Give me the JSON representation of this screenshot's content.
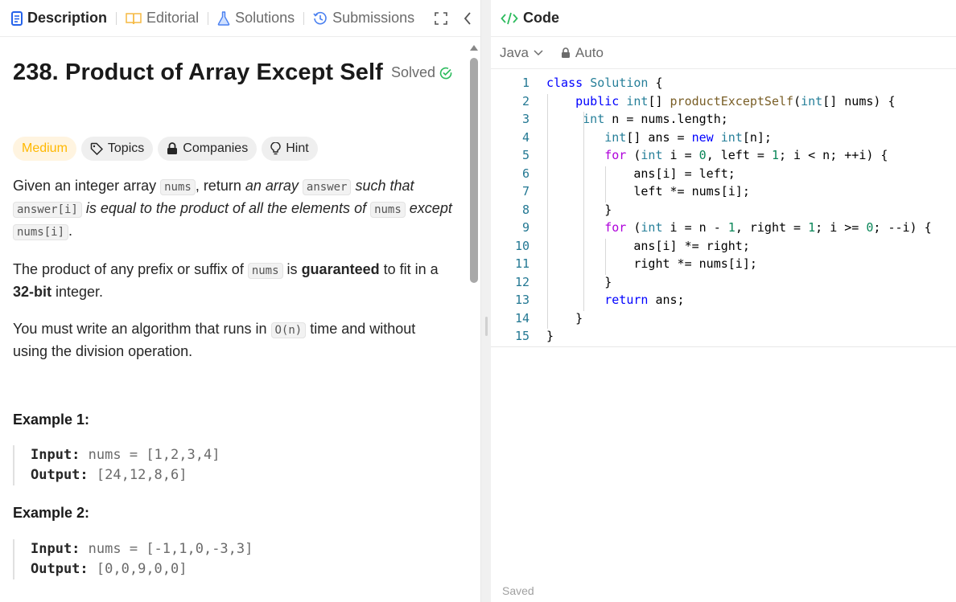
{
  "tabs": {
    "description": "Description",
    "editorial": "Editorial",
    "solutions": "Solutions",
    "submissions": "Submissions"
  },
  "problem": {
    "title": "238. Product of Array Except Self",
    "status": "Solved",
    "difficulty": "Medium",
    "topics": "Topics",
    "companies": "Companies",
    "hint": "Hint"
  },
  "desc": {
    "p1_a": "Given an integer array ",
    "p1_code1": "nums",
    "p1_b": ", return ",
    "p1_em1": "an array",
    "p1_code2": "answer",
    "p1_em2": " such that ",
    "p1_code3": "answer[i]",
    "p1_em3": " is equal to the product of all the elements of ",
    "p1_code4": "nums",
    "p1_em4": " except ",
    "p1_code5": "nums[i]",
    "p1_end": ".",
    "p2_a": "The product of any prefix or suffix of ",
    "p2_code": "nums",
    "p2_b": " is ",
    "p2_bold1": "guaranteed",
    "p2_c": " to fit in a ",
    "p2_bold2": "32-bit",
    "p2_d": " integer.",
    "p3_a": "You must write an algorithm that runs in ",
    "p3_code": "O(n)",
    "p3_b": " time and without using the division operation."
  },
  "examples": [
    {
      "title": "Example 1:",
      "input_label": "Input:",
      "input": "nums = [1,2,3,4]",
      "output_label": "Output:",
      "output": "[24,12,8,6]"
    },
    {
      "title": "Example 2:",
      "input_label": "Input:",
      "input": "nums = [-1,1,0,-3,3]",
      "output_label": "Output:",
      "output": "[0,0,9,0,0]"
    }
  ],
  "editor": {
    "title": "Code",
    "language": "Java",
    "mode": "Auto",
    "status": "Saved"
  },
  "code_lines": [
    "class Solution {",
    "    public int[] productExceptSelf(int[] nums) {",
    "     int n = nums.length;",
    "        int[] ans = new int[n];",
    "        for (int i = 0, left = 1; i < n; ++i) {",
    "            ans[i] = left;",
    "            left *= nums[i];",
    "        }",
    "        for (int i = n - 1, right = 1; i >= 0; --i) {",
    "            ans[i] *= right;",
    "            right *= nums[i];",
    "        }",
    "        return ans;",
    "    }",
    "}"
  ],
  "colors": {
    "accent_green": "#2cbb5d",
    "medium": "#ffb800",
    "keyword": "#0000ff",
    "type": "#267f99",
    "function": "#795e26",
    "number": "#098658",
    "control": "#af00db"
  }
}
